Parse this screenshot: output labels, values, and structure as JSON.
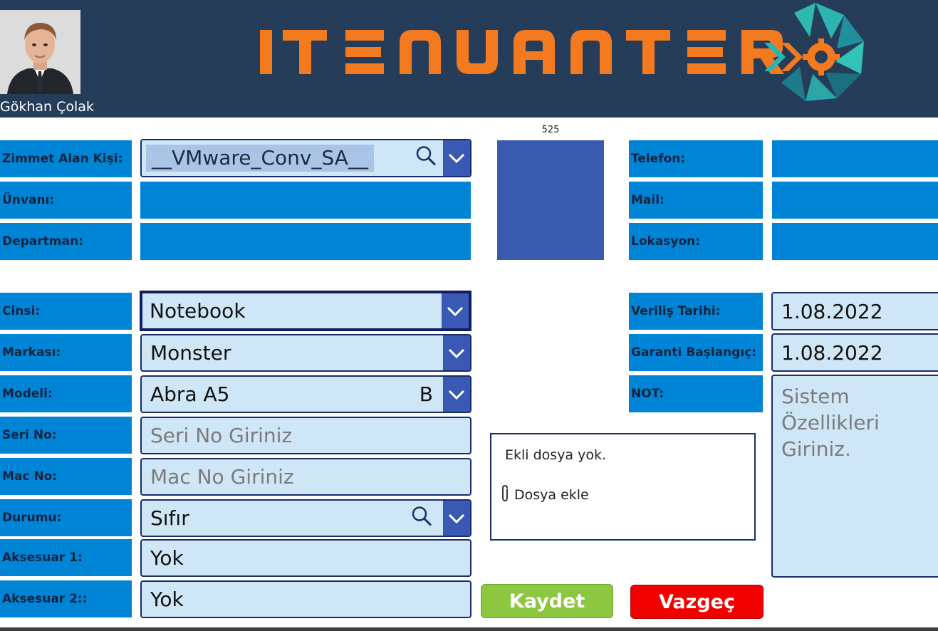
{
  "header": {
    "user_name": "Gökhan Çolak",
    "logo_text": "IT ENVANTER"
  },
  "employee": {
    "assignee": {
      "label": "Zimmet Alan Kişi:",
      "value": "__VMware_Conv_SA__"
    },
    "title": {
      "label": "Ünvanı:"
    },
    "department": {
      "label": "Departman:"
    },
    "phone": {
      "label": "Telefon:"
    },
    "mail": {
      "label": "Mail:"
    },
    "location": {
      "label": "Lokasyon:"
    },
    "counter": "525"
  },
  "device": {
    "type": {
      "label": "Cinsi:",
      "value": "Notebook"
    },
    "brand": {
      "label": "Markası:",
      "value": "Monster"
    },
    "model": {
      "label": "Modeli:",
      "value": "Abra A5",
      "suffix": "B"
    },
    "serial": {
      "label": "Seri No:",
      "placeholder": "Seri No Giriniz"
    },
    "mac": {
      "label": "Mac No:",
      "placeholder": "Mac No Giriniz"
    },
    "status": {
      "label": "Durumu:",
      "value": "Sıfır"
    },
    "accessory1": {
      "label": "Aksesuar 1:",
      "value": "Yok"
    },
    "accessory2": {
      "label": "Aksesuar 2::",
      "value": "Yok"
    }
  },
  "dates": {
    "delivery": {
      "label": "Veriliş Tarihi:",
      "value": "1.08.2022"
    },
    "warranty_start": {
      "label": "Garanti Başlangıç:",
      "value": "1.08.2022"
    },
    "note": {
      "label": "NOT:",
      "placeholder": "Sistem Özellikleri Giriniz."
    }
  },
  "attachments": {
    "empty_text": "Ekli dosya yok.",
    "add_label": "Dosya ekle"
  },
  "actions": {
    "save": "Kaydet",
    "cancel": "Vazgeç"
  },
  "colors": {
    "header_bg": "#263d5a",
    "label_bg": "#0084d6",
    "input_bg": "#cfe6f6",
    "dropdown_btn": "#3a59b5",
    "logo_orange": "#f47a20",
    "save_green": "#8dc63f",
    "cancel_red": "#f20000"
  }
}
